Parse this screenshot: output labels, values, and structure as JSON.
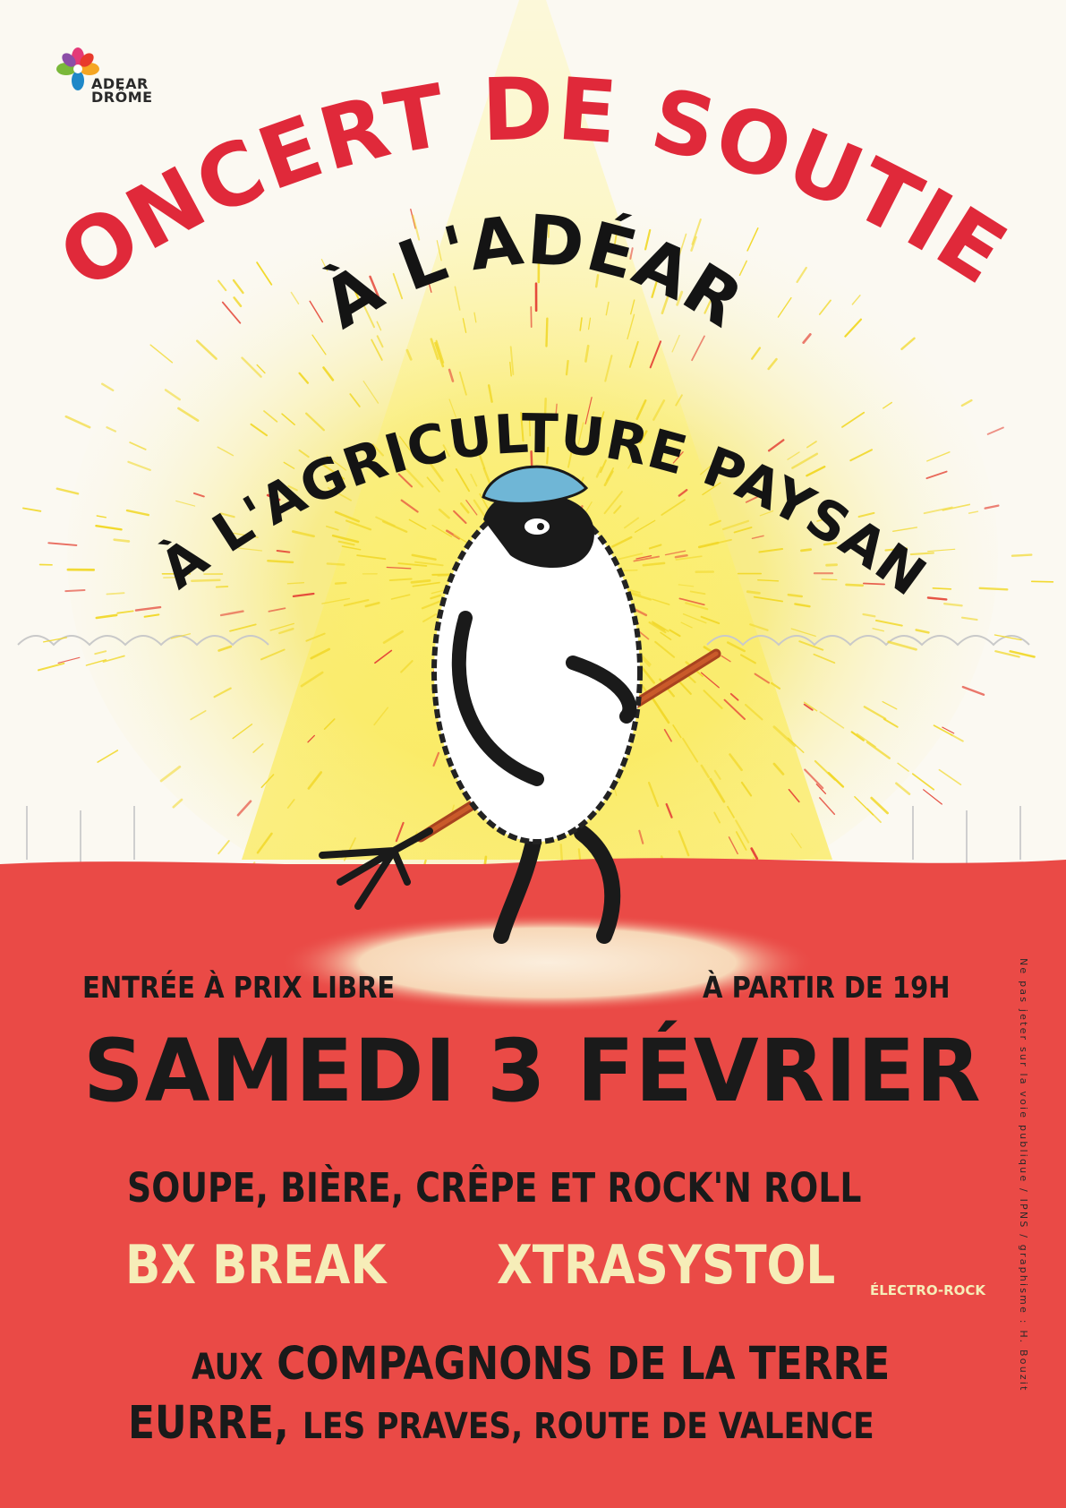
{
  "logo": {
    "line1": "ADEAR",
    "line2": "DRÔME",
    "icon": "flower-logo-icon"
  },
  "title": {
    "line1": "CONCERT DE SOUTIEN",
    "line2": "À L'ADÉAR",
    "line3": "ET À L'AGRICULTURE PAYSANNE"
  },
  "info": {
    "entry": "ENTRÉE À PRIX LIBRE",
    "time": "À PARTIR DE 19H",
    "date": "SAMEDI 3 FÉVRIER",
    "menu": "SOUPE, BIÈRE, CRÊPE ET ROCK'N ROLL",
    "band1": "BX BREAK",
    "band2": "XTRASYSTOL",
    "band2_genre": "ÉLECTRO-ROCK",
    "venue_prefix": "AUX",
    "venue_name": "COMPAGNONS DE LA TERRE",
    "town": "EURRE,",
    "address": "LES PRAVES, ROUTE DE VALENCE"
  },
  "credit": "Ne pas jeter sur la voie publique / IPNS / graphisme : H. Bouzit",
  "colors": {
    "red_title": "#e0293a",
    "red_ground": "#ea4a46",
    "cream_text": "#f6edb8",
    "glow_yellow": "#f7e84a"
  }
}
